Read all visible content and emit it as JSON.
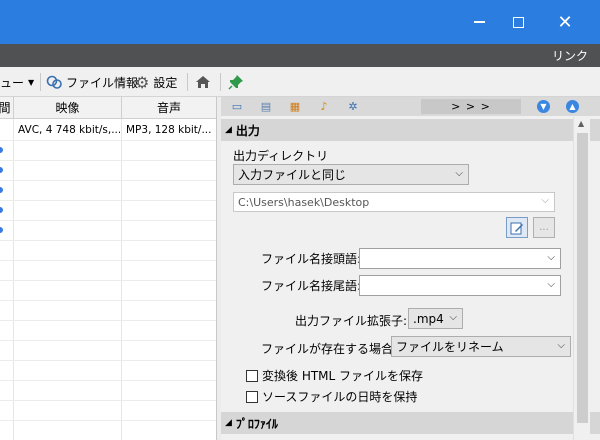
{
  "window": {
    "controls": {
      "minimize": "—",
      "maximize": "",
      "close": "✕"
    }
  },
  "menubar": {
    "link": "リンク"
  },
  "toolbar": {
    "menu_label": "ビュー",
    "file_info": "ファイル情報",
    "settings": "設定"
  },
  "file_list": {
    "columns": [
      "間",
      "映像",
      "音声"
    ],
    "rows": [
      {
        "video": "AVC, 4 748 kbit/s,...",
        "audio": "MP3, 128 kbit/..."
      }
    ]
  },
  "panel": {
    "nav_label": "> > >",
    "output_section": "出力",
    "output_dir_label": "出力ディレクトリ",
    "output_dir_value": "入力ファイルと同じ",
    "output_path": "C:\\Users\\hasek\\Desktop",
    "browse_label": "...",
    "prefix_label": "ファイル名接頭語:",
    "prefix_value": "",
    "suffix_label": "ファイル名接尾語:",
    "suffix_value": "",
    "ext_label": "出力ファイル拡張子:",
    "ext_value": ".mp4",
    "exists_label": "ファイルが存在する場合:",
    "exists_value": "ファイルをリネーム",
    "save_html_label": "変換後 HTML ファイルを保存",
    "keep_date_label": "ソースファイルの日時を保持",
    "profile_section": "ﾌﾟﾛﾌｧｲﾙ"
  }
}
